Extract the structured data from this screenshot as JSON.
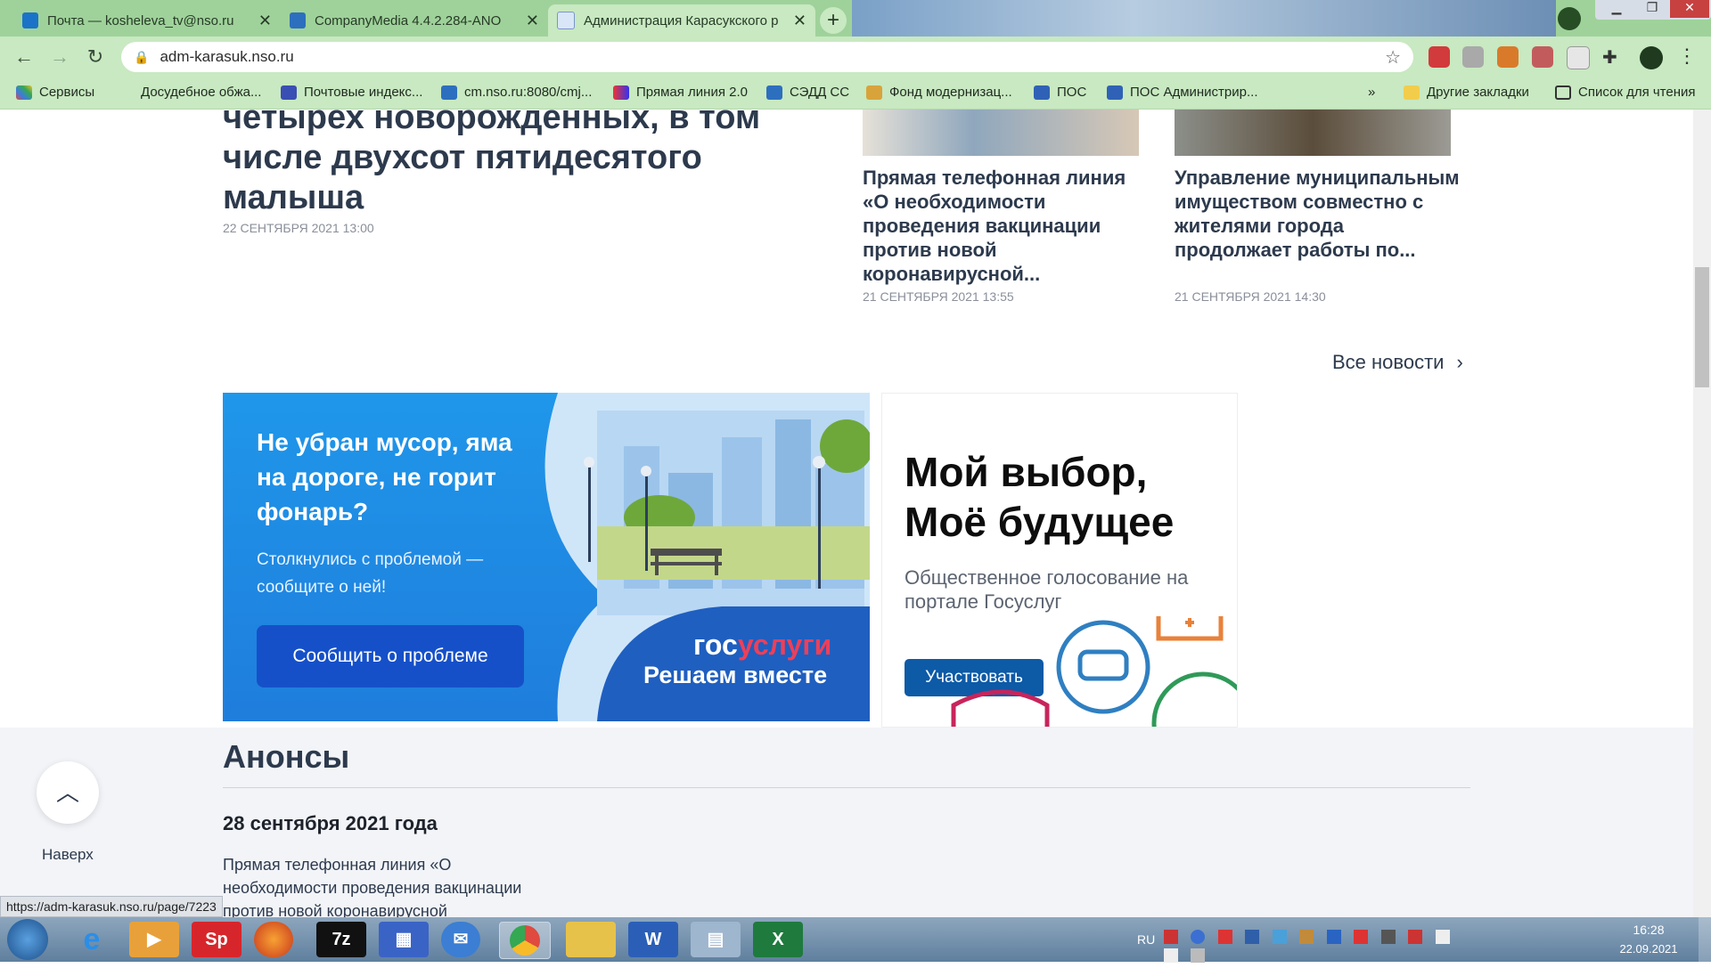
{
  "browser": {
    "tabs": [
      {
        "label": "Почта — kosheleva_tv@nso.ru",
        "icon": "outlook-icon"
      },
      {
        "label": "CompanyMedia 4.4.2.284-ANO",
        "icon": "companymedia-icon"
      },
      {
        "label": "Администрация Карасукского р",
        "icon": "site-crest-icon"
      }
    ],
    "address": "adm-karasuk.nso.ru",
    "bookmarks": [
      "Сервисы",
      "Досудебное обжа...",
      "Почтовые индекс...",
      "cm.nso.ru:8080/cmj...",
      "Прямая линия 2.0",
      "СЭДД СС",
      "Фонд модернизац...",
      "ПОС",
      "ПОС Администрир..."
    ],
    "bookmarks_more": "»",
    "other_bookmarks": "Другие закладки",
    "reading_list": "Список для чтения",
    "status_url": "https://adm-karasuk.nso.ru/page/7223"
  },
  "page": {
    "main_news": {
      "title": "четырех новорожденных, в том числе двухсот пятидесятого малыша",
      "date": "22 сентября 2021 13:00"
    },
    "news_cards": [
      {
        "title": "Прямая телефонная линия «О необходимости проведения вакцинации против новой коронавирусной...",
        "date": "21 сентября 2021 13:55"
      },
      {
        "title": "Управление муниципальным имуществом совместно с жителями города продолжает работы по...",
        "date": "21 сентября 2021 14:30"
      }
    ],
    "all_news": "Все новости",
    "banner_problem": {
      "heading": "Не убран мусор, яма на дороге, не горит фонарь?",
      "text": "Столкнулись с проблемой — сообщите о ней!",
      "button": "Сообщить о проблеме",
      "brand_gos": "гос",
      "brand_uslugi": "услуги",
      "brand_tagline": "Решаем вместе"
    },
    "banner_vote": {
      "heading": "Мой выбор, Моё будущее",
      "text": "Общественное голосование на портале Госуслуг",
      "button": "Участвовать"
    },
    "anons": {
      "title": "Анонсы",
      "date": "28 сентября 2021 года",
      "text": "Прямая телефонная линия «О необходимости проведения вакцинации против новой коронавирусной"
    },
    "to_top": "Наверх"
  },
  "taskbar": {
    "lang": "RU",
    "time": "16:28",
    "date": "22.09.2021"
  }
}
